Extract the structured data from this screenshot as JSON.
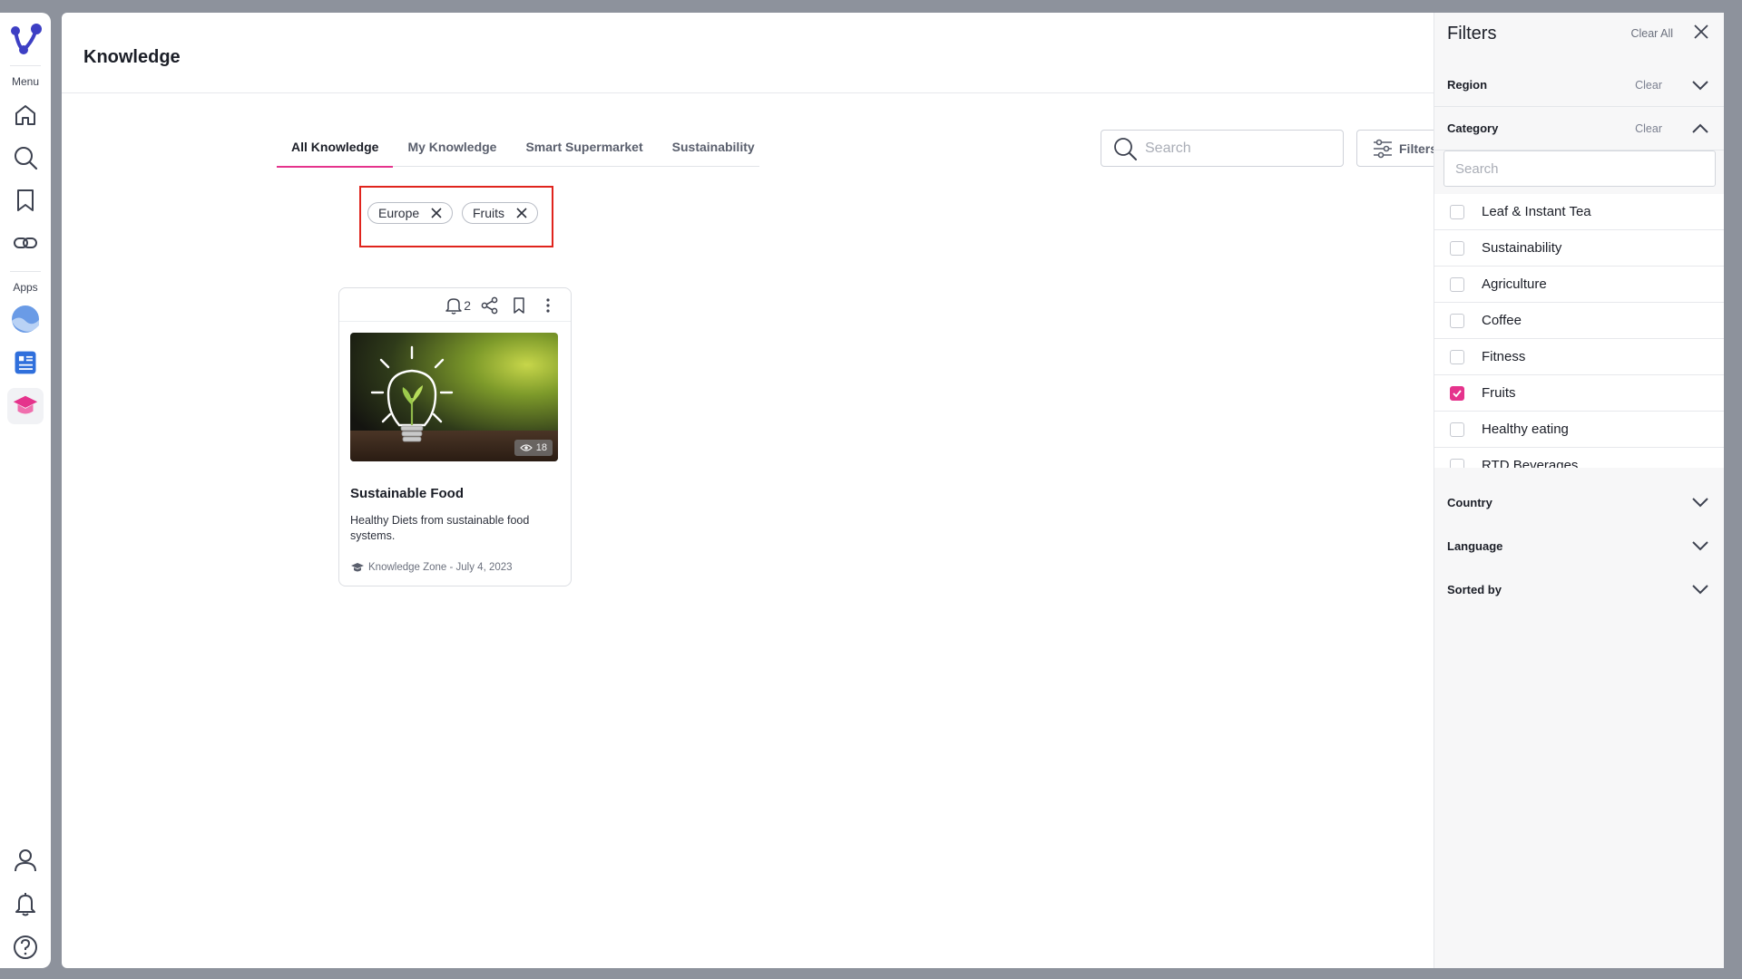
{
  "sidebar": {
    "menu_label": "Menu",
    "apps_label": "Apps",
    "nav_items": [
      {
        "name": "home-icon"
      },
      {
        "name": "search-icon"
      },
      {
        "name": "bookmark-icon"
      },
      {
        "name": "link-icon"
      }
    ],
    "app_items": [
      {
        "name": "wave-app-icon",
        "color": "#5b8de0"
      },
      {
        "name": "document-app-icon",
        "color": "#2f6fdc"
      },
      {
        "name": "graduation-cap-app-icon",
        "color": "#e5338c",
        "active": true
      }
    ],
    "bottom_items": [
      {
        "name": "user-icon"
      },
      {
        "name": "bell-icon"
      },
      {
        "name": "help-icon"
      }
    ]
  },
  "page": {
    "title": "Knowledge"
  },
  "tabs": [
    {
      "label": "All Knowledge",
      "active": true
    },
    {
      "label": "My Knowledge",
      "active": false
    },
    {
      "label": "Smart Supermarket",
      "active": false
    },
    {
      "label": "Sustainability",
      "active": false
    }
  ],
  "search": {
    "placeholder": "Search",
    "value": ""
  },
  "filters_button": {
    "label": "Filters"
  },
  "active_filters": [
    {
      "label": "Europe"
    },
    {
      "label": "Fruits"
    }
  ],
  "card": {
    "notification_count": "2",
    "views": "18",
    "title": "Sustainable Food",
    "description": "Healthy Diets from sustainable food systems.",
    "meta": "Knowledge Zone - July 4, 2023"
  },
  "filters_panel": {
    "title": "Filters",
    "clear_all": "Clear All",
    "sections": {
      "region": {
        "label": "Region",
        "clear": "Clear",
        "expanded": false
      },
      "category": {
        "label": "Category",
        "clear": "Clear",
        "expanded": true
      },
      "country": {
        "label": "Country",
        "expanded": false
      },
      "language": {
        "label": "Language",
        "expanded": false
      },
      "sorted_by": {
        "label": "Sorted by",
        "expanded": false
      }
    },
    "category_search_placeholder": "Search",
    "categories": [
      {
        "label": "Leaf & Instant Tea",
        "checked": false
      },
      {
        "label": "Sustainability",
        "checked": false
      },
      {
        "label": "Agriculture",
        "checked": false
      },
      {
        "label": "Coffee",
        "checked": false
      },
      {
        "label": "Fitness",
        "checked": false
      },
      {
        "label": "Fruits",
        "checked": true
      },
      {
        "label": "Healthy eating",
        "checked": false
      },
      {
        "label": "RTD Beverages",
        "checked": false
      }
    ]
  },
  "colors": {
    "accent": "#e5338c",
    "highlight_box": "#e0241d",
    "background": "#8d929c"
  }
}
